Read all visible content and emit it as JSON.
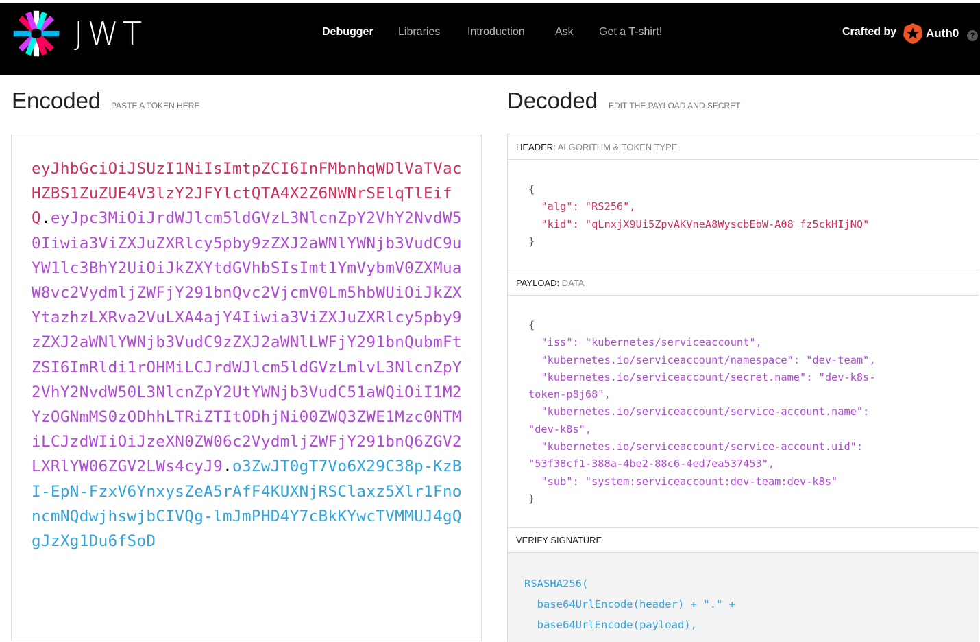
{
  "brand": {
    "wordmark": "JWT"
  },
  "nav": {
    "items": [
      {
        "label": "Debugger",
        "active": true
      },
      {
        "label": "Libraries",
        "active": false
      },
      {
        "label": "Introduction",
        "active": false
      },
      {
        "label": "Ask",
        "active": false
      },
      {
        "label": "Get a T-shirt!",
        "active": false
      }
    ],
    "crafted_by": "Crafted by",
    "auth0": "Auth0",
    "help": "?"
  },
  "encoded": {
    "title": "Encoded",
    "subtitle": "PASTE A TOKEN HERE",
    "token_header": "eyJhbGciOiJSUzI1NiIsImtpZCI6InFMbnhqWDlVaTVacHZBS1ZuZUE4V3lzY2JFYlctQTA4X2Z6NWNrSElqTlEifQ",
    "token_payload": "eyJpc3MiOiJrdWJlcm5ldGVzL3NlcnZpY2VhY2NvdW50Iiwia3ViZXJuZXRlcy5pby9zZXJ2aWNlYWNjb3VudC9uYW1lc3BhY2UiOiJkZXYtdGVhbSIsImt1YmVybmV0ZXMuaW8vc2VydmljZWFjY291bnQvc2VjcmV0Lm5hbWUiOiJkZXYtazhzLXRva2VuLXA4ajY4Iiwia3ViZXJuZXRlcy5pby9zZXJ2aWNlYWNjb3VudC9zZXJ2aWNlLWFjY291bnQubmFtZSI6ImRldi1rOHMiLCJrdWJlcm5ldGVzLmlvL3NlcnZpY2VhY2NvdW50L3NlcnZpY2UtYWNjb3VudC51aWQiOiI1M2YzOGNmMS0zODhhLTRiZTItODhjNi00ZWQ3ZWE1Mzc0NTMiLCJzdWIiOiJzeXN0ZW06c2VydmljZWFjY291bnQ6ZGV2LXRlYW06ZGV2LWs4cyJ9",
    "token_signature": "o3ZwJT0gT7Vo6X29C38p-KzBI-EpN-FzxV6YnxysZeA5rAfF4KUXNjRSClaxz5Xlr1FnoncmNQdwjhswjbCIVQg-lmJmPHD4Y7cBkKYwcTVMMUJ4gQgJzXg1Du6fSoD"
  },
  "decoded": {
    "title": "Decoded",
    "subtitle": "EDIT THE PAYLOAD AND SECRET",
    "header": {
      "label": "HEADER:",
      "sublabel": "ALGORITHM & TOKEN TYPE",
      "lines": [
        "{",
        "  \"alg\": \"RS256\",",
        "  \"kid\": \"qLnxjX9Ui5ZpvAKVneA8WyscbEbW-A08_fz5ckHIjNQ\"",
        "}"
      ]
    },
    "payload": {
      "label": "PAYLOAD:",
      "sublabel": "DATA",
      "lines": [
        "{",
        "  \"iss\": \"kubernetes/serviceaccount\",",
        "  \"kubernetes.io/serviceaccount/namespace\": \"dev-team\",",
        "  \"kubernetes.io/serviceaccount/secret.name\": \"dev-k8s-",
        "token-p8j68\",",
        "  \"kubernetes.io/serviceaccount/service-account.name\":",
        "\"dev-k8s\",",
        "  \"kubernetes.io/serviceaccount/service-account.uid\":",
        "\"53f38cf1-388a-4be2-88c6-4ed7ea537453\",",
        "  \"sub\": \"system:serviceaccount:dev-team:dev-k8s\"",
        "}"
      ]
    },
    "verify": {
      "label": "VERIFY SIGNATURE",
      "lines": [
        "RSASHA256(",
        "  base64UrlEncode(header) + \".\" +",
        "  base64UrlEncode(payload),"
      ]
    }
  },
  "colors": {
    "header_bg": "#000000",
    "token_header": "#d1305c",
    "token_payload": "#b14ad6",
    "token_signature": "#2fa4de"
  }
}
